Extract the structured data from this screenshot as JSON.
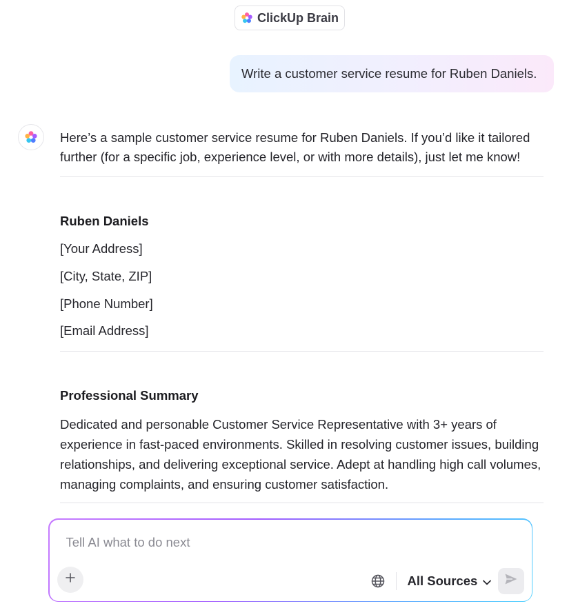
{
  "header": {
    "title": "ClickUp Brain",
    "logo_icon": "clickup-brain-logo-icon"
  },
  "user_message": "Write a customer service resume for Ruben Daniels.",
  "assistant": {
    "avatar_icon": "clickup-brain-logo-icon",
    "intro": "Here’s a sample customer service resume for Ruben Daniels. If you’d like it tailored further (for a specific job, experience level, or with more details), just let me know!",
    "resume": {
      "name": "Ruben Daniels",
      "address": "[Your Address]",
      "city_state_zip": "[City, State, ZIP]",
      "phone": "[Phone Number]",
      "email": "[Email Address]",
      "summary_title": "Professional Summary",
      "summary": "Dedicated and personable Customer Service Representative with 3+ years of experience in fast-paced environments. Skilled in resolving customer issues, building relationships, and delivering exceptional service. Adept at handling high call volumes, managing complaints, and ensuring customer satisfaction."
    }
  },
  "composer": {
    "placeholder": "Tell AI what to do next",
    "value": "",
    "sources_label": "All Sources",
    "icons": {
      "add": "plus-icon",
      "web": "globe-icon",
      "dropdown": "chevron-down-icon",
      "send": "send-icon"
    }
  },
  "colors": {
    "user_bubble_start": "#e8f3ff",
    "user_bubble_end": "#fbe9fa",
    "composer_border_start": "#c77dff",
    "composer_border_end": "#4fd1ff"
  }
}
